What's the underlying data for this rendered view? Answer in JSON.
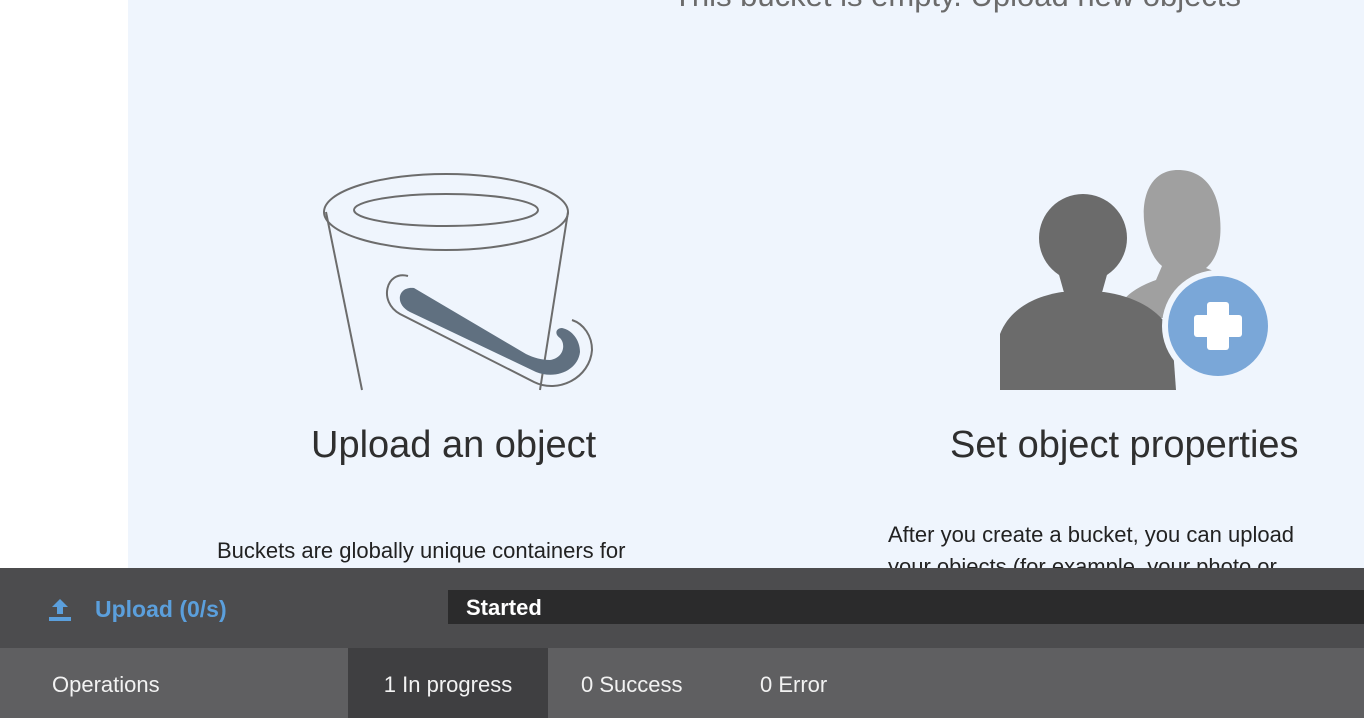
{
  "main": {
    "empty_message": "This bucket is empty. Upload new objects",
    "cards": {
      "upload": {
        "title": "Upload an object",
        "description": "Buckets are globally unique containers for",
        "icon": "bucket-icon"
      },
      "properties": {
        "title": "Set object properties",
        "description_line1": "After you create a bucket, you can upload",
        "description_line2": "your objects (for example, your photo or",
        "icon": "user-add-icon"
      }
    }
  },
  "operations_panel": {
    "upload_label": "Upload (0/s)",
    "upload_icon": "upload-icon",
    "status_label": "Started",
    "tabs": {
      "operations": "Operations",
      "in_progress": "1 In progress",
      "success": "0 Success",
      "error": "0 Error"
    }
  },
  "colors": {
    "accent": "#5b9fdc",
    "content_bg": "#eff5fd",
    "panel_bg": "#4c4c4e",
    "tabs_bg": "#5f5f61",
    "active_tab_bg": "#3f3f41"
  }
}
